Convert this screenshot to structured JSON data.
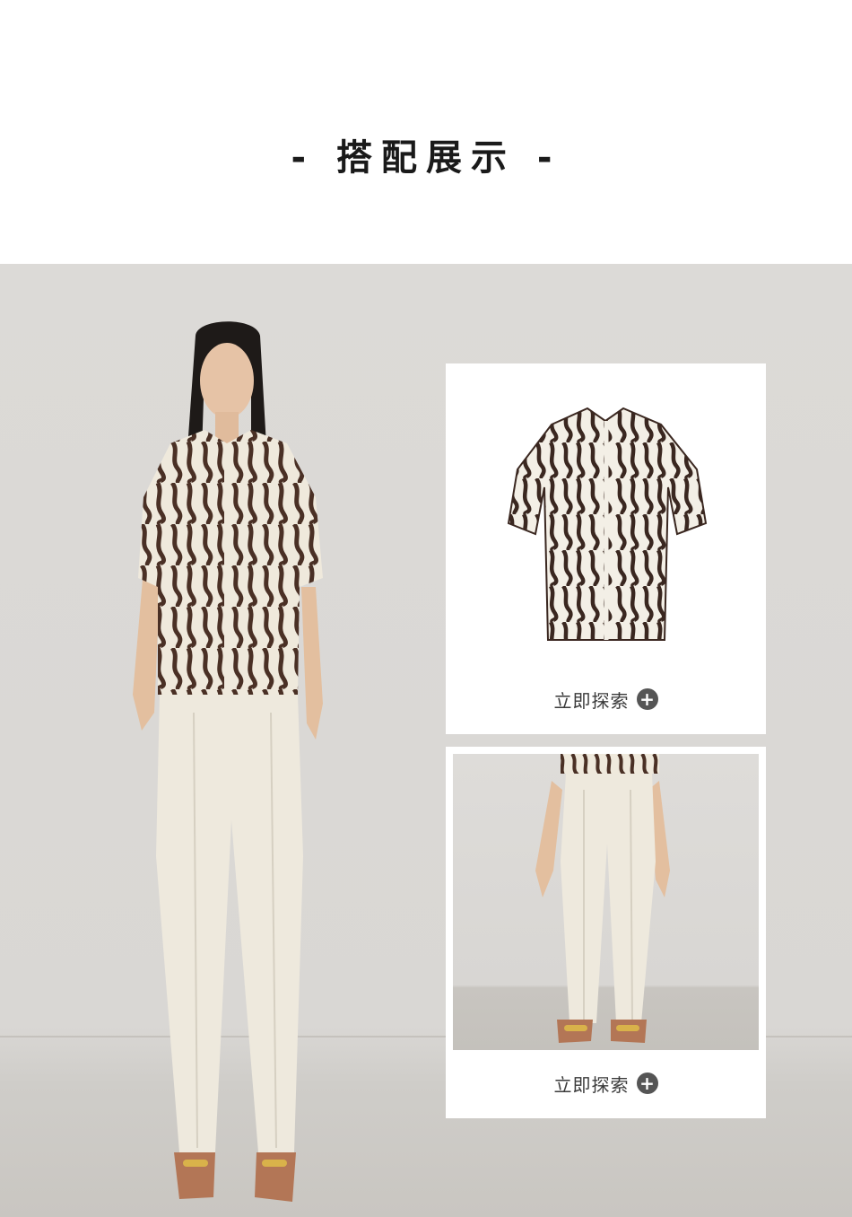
{
  "section": {
    "title": "- 搭配展示 -"
  },
  "products": [
    {
      "name": "shirt",
      "cta": "立即探索",
      "icon": "plus-circle-icon"
    },
    {
      "name": "pants",
      "cta": "立即探索",
      "icon": "plus-circle-icon"
    }
  ],
  "colors": {
    "background": "#ffffff",
    "scene": "#dad8d5",
    "accent": "#555555",
    "print_dark": "#4a3025",
    "print_light": "#efe9dc",
    "trousers": "#eee9dd",
    "shoes": "#b37656"
  }
}
